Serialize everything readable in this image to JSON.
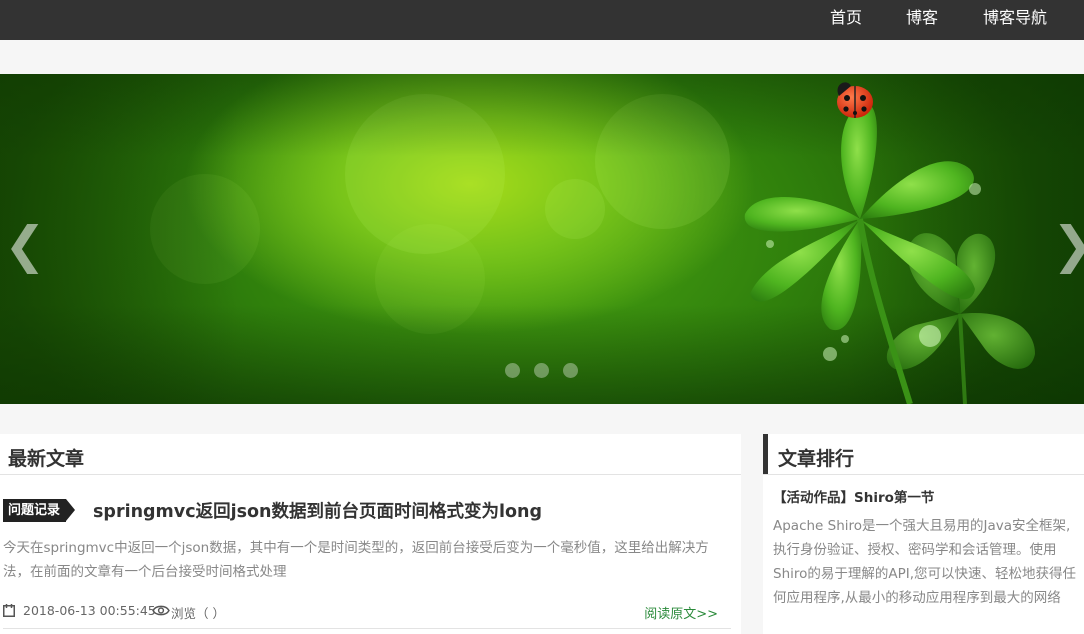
{
  "nav": {
    "items": [
      {
        "label": "首页"
      },
      {
        "label": "博客"
      },
      {
        "label": "博客导航"
      }
    ]
  },
  "carousel": {
    "prev_glyph": "❮",
    "next_glyph": "❯",
    "slide_count": 3
  },
  "latest": {
    "heading": "最新文章",
    "article": {
      "tag": "问题记录",
      "title": "springmvc返回json数据到前台页面时间格式变为long",
      "summary": "今天在springmvc中返回一个json数据，其中有一个是时间类型的，返回前台接受后变为一个毫秒值，这里给出解决方法，在前面的文章有一个后台接受时间格式处理",
      "date": "2018-06-13 00:55:45",
      "views_label": "浏览（ ）",
      "read_more": "阅读原文>>"
    }
  },
  "ranking": {
    "heading": "文章排行",
    "item": {
      "title": "【活动作品】Shiro第一节",
      "body": "Apache Shiro是一个强大且易用的Java安全框架,执行身份验证、授权、密码学和会话管理。使用Shiro的易于理解的API,您可以快速、轻松地获得任何应用程序,从最小的移动应用程序到最大的网络"
    }
  },
  "colors": {
    "topbar": "#333333",
    "banner_green": "#4aa512",
    "read_more": "#2a8a3a"
  }
}
